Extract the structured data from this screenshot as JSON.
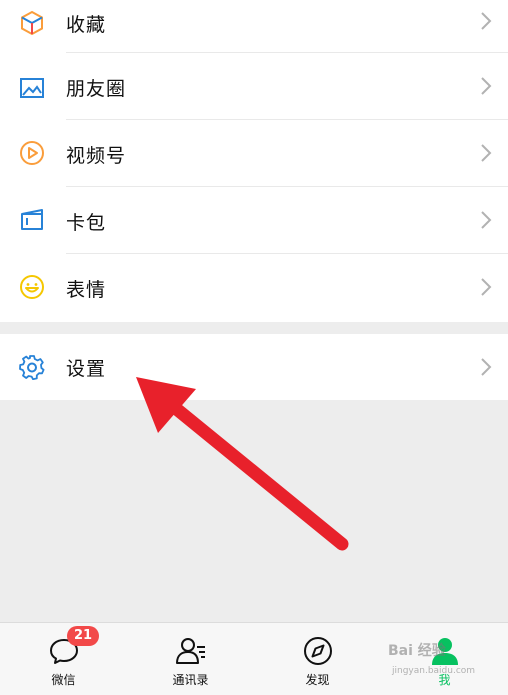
{
  "menu": {
    "items": [
      {
        "label": "收藏",
        "icon": "favorites-cube-icon"
      },
      {
        "label": "朋友圈",
        "icon": "moments-photo-icon"
      },
      {
        "label": "视频号",
        "icon": "channels-play-icon"
      },
      {
        "label": "卡包",
        "icon": "card-wallet-icon"
      },
      {
        "label": "表情",
        "icon": "sticker-smile-icon"
      }
    ],
    "settings": {
      "label": "设置",
      "icon": "gear-icon"
    }
  },
  "tabbar": {
    "tabs": [
      {
        "label": "微信",
        "badge": "21",
        "icon": "chat-bubble-icon"
      },
      {
        "label": "通讯录",
        "icon": "contacts-icon"
      },
      {
        "label": "发现",
        "icon": "compass-icon"
      },
      {
        "label": "我",
        "icon": "person-icon",
        "active": true
      }
    ]
  },
  "watermark": {
    "text": "Bai 经验",
    "sub": "jingyan.baidu.com"
  },
  "colors": {
    "accent_green": "#07c160",
    "badge_red": "#f24949",
    "arrow_red": "#e8212b"
  }
}
